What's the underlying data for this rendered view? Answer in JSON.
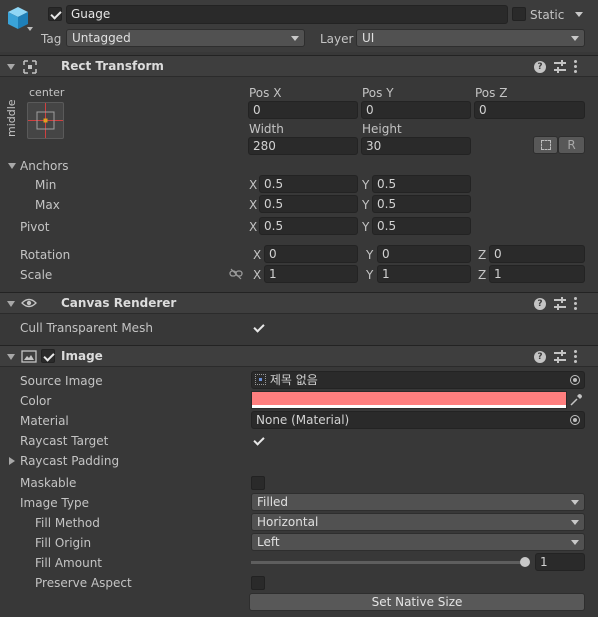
{
  "gameobject": {
    "name": "Guage",
    "active": true,
    "static_label": "Static",
    "static_checked": false,
    "tag_label": "Tag",
    "tag_value": "Untagged",
    "layer_label": "Layer",
    "layer_value": "UI"
  },
  "rect_transform": {
    "title": "Rect Transform",
    "anchor_preset_h": "center",
    "anchor_preset_v": "middle",
    "pos_x_label": "Pos X",
    "pos_x": "0",
    "pos_y_label": "Pos Y",
    "pos_y": "0",
    "pos_z_label": "Pos Z",
    "pos_z": "0",
    "width_label": "Width",
    "width": "280",
    "height_label": "Height",
    "height": "30",
    "r_button": "R",
    "anchors_label": "Anchors",
    "min_label": "Min",
    "min_x": "0.5",
    "min_y": "0.5",
    "max_label": "Max",
    "max_x": "0.5",
    "max_y": "0.5",
    "pivot_label": "Pivot",
    "pivot_x": "0.5",
    "pivot_y": "0.5",
    "rotation_label": "Rotation",
    "rot_x": "0",
    "rot_y": "0",
    "rot_z": "0",
    "scale_label": "Scale",
    "scale_x": "1",
    "scale_y": "1",
    "scale_z": "1",
    "axis_x": "X",
    "axis_y": "Y",
    "axis_z": "Z"
  },
  "canvas_renderer": {
    "title": "Canvas Renderer",
    "cull_label": "Cull Transparent Mesh",
    "cull_checked": true
  },
  "image": {
    "title": "Image",
    "enabled": true,
    "source_image_label": "Source Image",
    "source_image_value": "제목 없음",
    "color_label": "Color",
    "color_value": "#ff7f7f",
    "material_label": "Material",
    "material_value": "None (Material)",
    "raycast_target_label": "Raycast Target",
    "raycast_target_checked": true,
    "raycast_padding_label": "Raycast Padding",
    "maskable_label": "Maskable",
    "maskable_checked": false,
    "image_type_label": "Image Type",
    "image_type_value": "Filled",
    "fill_method_label": "Fill Method",
    "fill_method_value": "Horizontal",
    "fill_origin_label": "Fill Origin",
    "fill_origin_value": "Left",
    "fill_amount_label": "Fill Amount",
    "fill_amount_value": "1",
    "fill_amount_fraction": 1,
    "preserve_aspect_label": "Preserve Aspect",
    "preserve_aspect_checked": false,
    "set_native_size_label": "Set Native Size"
  },
  "icons": {
    "help": "?"
  }
}
